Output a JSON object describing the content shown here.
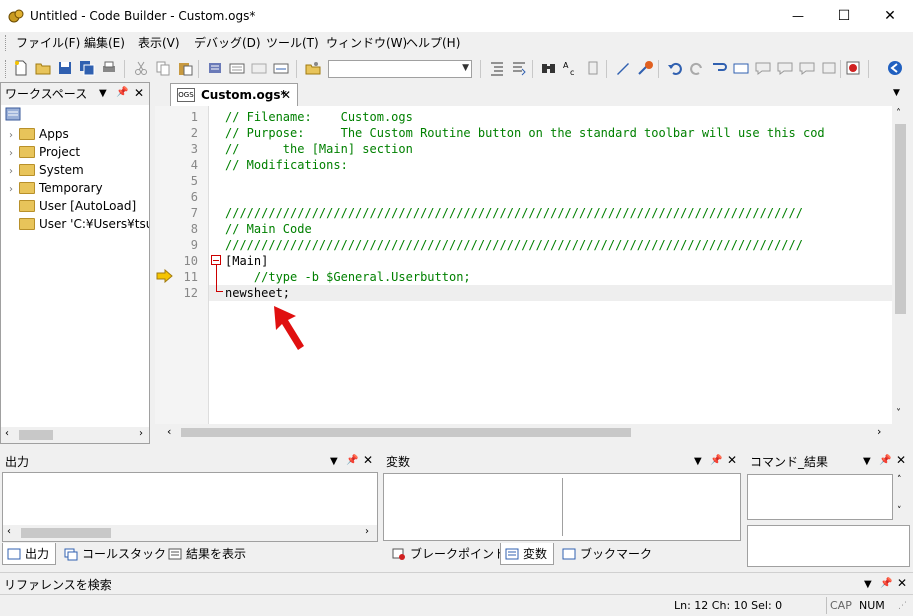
{
  "window": {
    "title": "Untitled - Code Builder - Custom.ogs*",
    "minimize": "—",
    "maximize": "☐",
    "close": "✕"
  },
  "menu": [
    "ファイル(F)",
    "編集(E)",
    "表示(V)",
    "デバッグ(D)",
    "ツール(T)",
    "ウィンドウ(W)",
    "ヘルプ(H)"
  ],
  "workspace": {
    "title": "ワークスペース",
    "items": [
      "Apps",
      "Project",
      "System",
      "Temporary",
      "User  [AutoLoad]",
      "User 'C:¥Users¥tsuk"
    ]
  },
  "editor": {
    "tab_label": "Custom.ogs*",
    "tab_icon_text": "OGS",
    "lines": [
      {
        "n": "1",
        "text": "// Filename:    Custom.ogs"
      },
      {
        "n": "2",
        "text": "// Purpose:     The Custom Routine button on the standard toolbar will use this cod"
      },
      {
        "n": "3",
        "text": "//      the [Main] section"
      },
      {
        "n": "4",
        "text": "// Modifications:"
      },
      {
        "n": "5",
        "text": ""
      },
      {
        "n": "6",
        "text": ""
      },
      {
        "n": "7",
        "text": "////////////////////////////////////////////////////////////////////////////////"
      },
      {
        "n": "8",
        "text": "// Main Code"
      },
      {
        "n": "9",
        "text": "////////////////////////////////////////////////////////////////////////////////"
      },
      {
        "n": "10",
        "text": "[Main]"
      },
      {
        "n": "11",
        "text": "    //type -b $General.Userbutton;"
      },
      {
        "n": "12",
        "text": "newsheet;"
      }
    ]
  },
  "output": {
    "title": "出力",
    "tabs": [
      "出力",
      "コールスタック",
      "結果を表示"
    ]
  },
  "variables": {
    "title": "変数",
    "tabs": [
      "ブレークポイント",
      "変数",
      "ブックマーク"
    ]
  },
  "command": {
    "title": "コマンド_結果"
  },
  "reference": {
    "title": "リファレンスを検索"
  },
  "status": {
    "position": "Ln: 12 Ch: 10 Sel: 0",
    "cap": "CAP",
    "num": "NUM"
  },
  "colors": {
    "comment": "#008000",
    "arrow": "#e01010",
    "fold": "#cc0000",
    "bookmark": "#f5c400"
  }
}
